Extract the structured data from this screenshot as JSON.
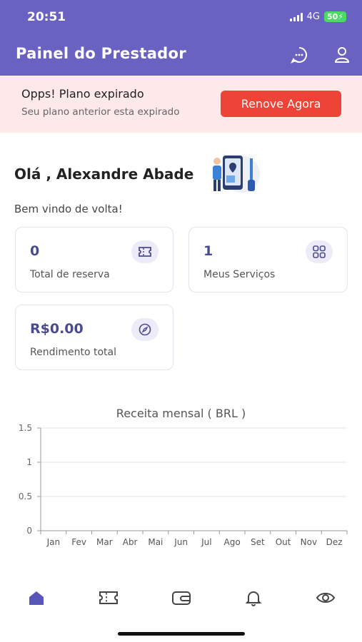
{
  "status_bar": {
    "time": "20:51",
    "network": "4G",
    "battery": "50"
  },
  "header": {
    "title": "Painel do Prestador"
  },
  "banner": {
    "title": "Opps! Plano expirado",
    "subtitle": "Seu plano anterior esta expirado",
    "button_label": "Renove Agora"
  },
  "greeting": "Olá , Alexandre Abade",
  "welcome": "Bem vindo de volta!",
  "stats": [
    {
      "value": "0",
      "label": "Total de reserva",
      "icon": "ticket-icon"
    },
    {
      "value": "1",
      "label": "Meus Serviços",
      "icon": "grid-icon"
    },
    {
      "value": "R$0.00",
      "label": "Rendimento total",
      "icon": "compass-icon"
    }
  ],
  "colors": {
    "primary": "#6a62c1",
    "accent": "#ee4337",
    "banner_bg": "#fde8ea"
  },
  "chart_data": {
    "type": "line",
    "title": "Receita mensal ( BRL )",
    "categories": [
      "Jan",
      "Fev",
      "Mar",
      "Abr",
      "Mai",
      "Jun",
      "Jul",
      "Ago",
      "Set",
      "Out",
      "Nov",
      "Dez"
    ],
    "y_ticks": [
      "0",
      "0.5",
      "1",
      "1.5"
    ],
    "ylim": [
      0,
      1.5
    ],
    "series": [
      {
        "values": [
          0,
          0,
          0,
          0,
          0,
          0,
          0,
          0,
          0,
          0,
          0,
          0
        ]
      }
    ],
    "grid": true
  },
  "bottom_nav": [
    {
      "icon": "home-icon",
      "active": true
    },
    {
      "icon": "ticket-icon",
      "active": false
    },
    {
      "icon": "wallet-icon",
      "active": false
    },
    {
      "icon": "bell-icon",
      "active": false
    },
    {
      "icon": "eye-icon",
      "active": false
    }
  ]
}
